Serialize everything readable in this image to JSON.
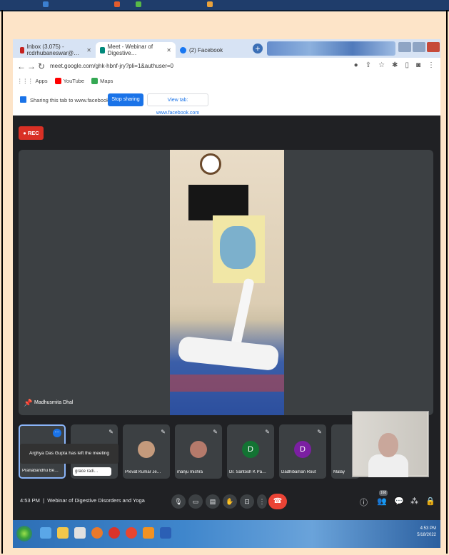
{
  "browser": {
    "tabs": [
      {
        "label": "Inbox (3,075) - rcdrhubaneswar@…",
        "color": "#c5221f"
      },
      {
        "label": "Meet - Webinar of Digestive…",
        "color": "#00897b"
      },
      {
        "label": "(2) Facebook",
        "color": "#1877f2"
      }
    ],
    "url": "meet.google.com/ghk-hbnf-jry?pli=1&authuser=0",
    "bookmarks": [
      "Apps",
      "YouTube",
      "Maps"
    ]
  },
  "share_bar": {
    "message": "Sharing this tab to www.facebook.com",
    "stop_label": "Stop sharing",
    "view_label": "View tab: www.facebook.com"
  },
  "meet": {
    "rec_label": "REC",
    "presenter_name": "Madhusmita Dhal",
    "toast": "Arghya Das Gupta has left the meeting",
    "participants": [
      {
        "name": "Pranabandhu Be…",
        "avatar": "",
        "color": "#3c4043"
      },
      {
        "name": "grace radi…",
        "avatar": "",
        "color": "#3c4043"
      },
      {
        "name": "Prevat Kumar Je…",
        "avatar": "photo",
        "color": "#c49a7c"
      },
      {
        "name": "manju mishra",
        "avatar": "photo",
        "color": "#b57a6b"
      },
      {
        "name": "Dr. Santosh K Pa…",
        "avatar": "D",
        "color": "#137333"
      },
      {
        "name": "Dadhibaman Rout",
        "avatar": "D",
        "color": "#7b1fa2"
      },
      {
        "name": "Malay",
        "avatar": "",
        "color": "#3c4043"
      }
    ],
    "time": "4:53 PM",
    "meeting_title": "Webinar of Digestive Disorders and Yoga",
    "participant_count": "168"
  },
  "taskbar": {
    "time": "4:53 PM",
    "date": "5/18/2022"
  }
}
